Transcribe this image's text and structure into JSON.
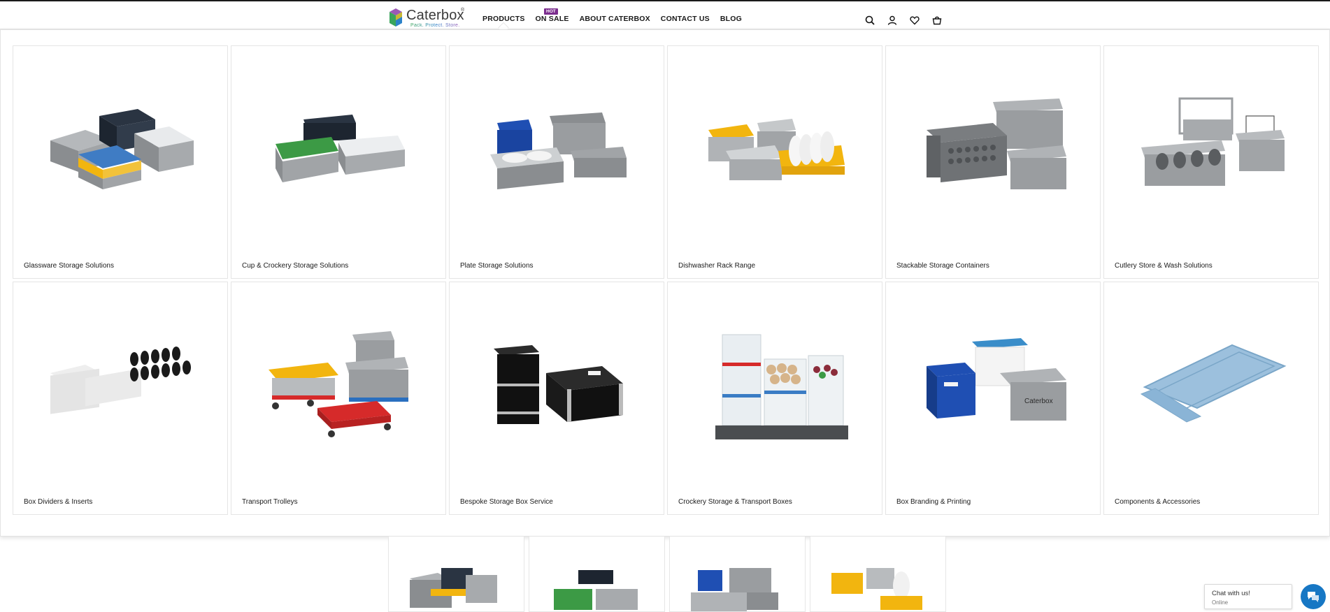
{
  "header": {
    "logo": {
      "wordmark": "Caterbox",
      "trademark": "®",
      "tagline": "Pack. Protect. Store."
    },
    "nav": [
      {
        "label": "PRODUCTS",
        "active": true
      },
      {
        "label": "ON SALE",
        "badge": "HOT"
      },
      {
        "label": "ABOUT CATERBOX"
      },
      {
        "label": "CONTACT US"
      },
      {
        "label": "BLOG"
      }
    ],
    "icons": [
      "search-icon",
      "account-icon",
      "wishlist-icon",
      "cart-icon"
    ]
  },
  "mega_menu": {
    "categories": [
      {
        "label": "Glassware Storage Solutions",
        "image": "glass-racks"
      },
      {
        "label": "Cup & Crockery Storage Solutions",
        "image": "cup-racks"
      },
      {
        "label": "Plate Storage Solutions",
        "image": "plate-boxes"
      },
      {
        "label": "Dishwasher Rack Range",
        "image": "dishwasher-racks"
      },
      {
        "label": "Stackable Storage Containers",
        "image": "grey-containers"
      },
      {
        "label": "Cutlery Store & Wash Solutions",
        "image": "cutlery-baskets"
      },
      {
        "label": "Box Dividers & Inserts",
        "image": "dividers"
      },
      {
        "label": "Transport Trolleys",
        "image": "trolleys"
      },
      {
        "label": "Bespoke Storage Box Service",
        "image": "bespoke-boxes"
      },
      {
        "label": "Crockery Storage & Transport Boxes",
        "image": "crockery-boxes"
      },
      {
        "label": "Box Branding & Printing",
        "image": "branded-boxes"
      },
      {
        "label": "Components & Accessories",
        "image": "lids"
      }
    ]
  },
  "chat": {
    "title": "Chat with us!",
    "status": "Online"
  },
  "colors": {
    "accent": "#7b2d8e",
    "chat": "#1777c4",
    "crate_grey": "#8a8d90",
    "rack_yellow": "#f2b50f",
    "rack_green": "#3c9a45",
    "box_blue": "#1f4fb3",
    "trolley_red": "#d62a2a",
    "lid_blue": "#8ab4d6"
  }
}
